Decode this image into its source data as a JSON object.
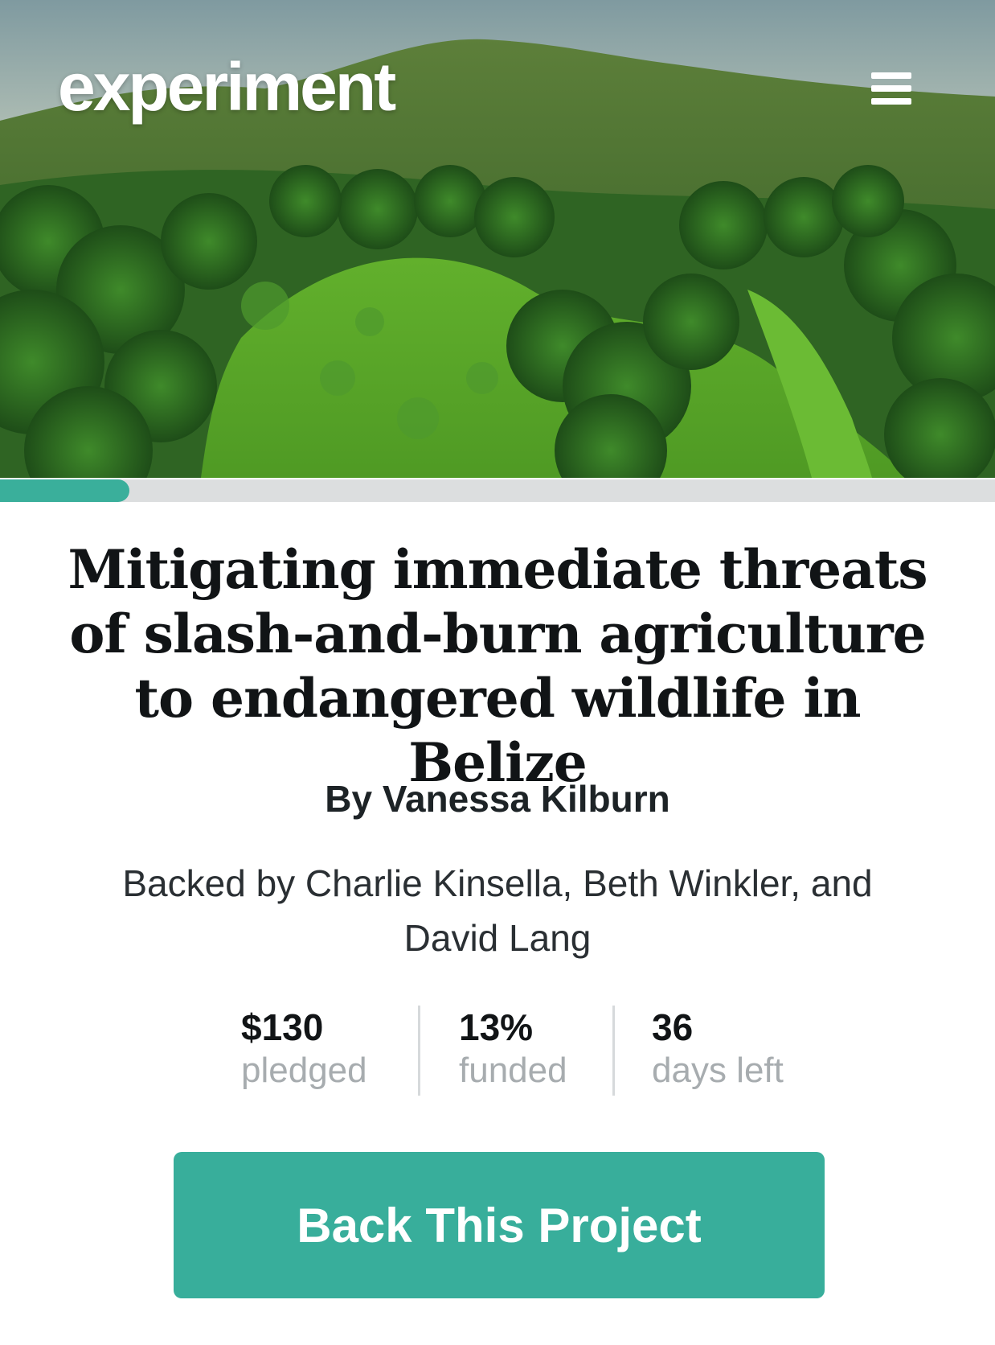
{
  "header": {
    "logo_text": "experiment",
    "menu_icon": "hamburger-menu-icon"
  },
  "hero_image": {
    "subject": "aerial rainforest landscape"
  },
  "progress": {
    "funded_fraction": 0.13
  },
  "project": {
    "title": "Mitigating immediate threats of slash-and-burn agriculture to endangered wildlife in Belize",
    "author": "By Vanessa Kilburn",
    "backers": "Backed by Charlie Kinsella, Beth Winkler, and David Lang"
  },
  "stats": [
    {
      "value": "$130",
      "label": "pledged"
    },
    {
      "value": "13%",
      "label": "funded"
    },
    {
      "value": "36",
      "label": "days left"
    }
  ],
  "cta": {
    "label": "Back This Project"
  },
  "colors": {
    "accent": "#38ae9b",
    "track": "#dcdedf",
    "muted": "#a7acaf"
  }
}
